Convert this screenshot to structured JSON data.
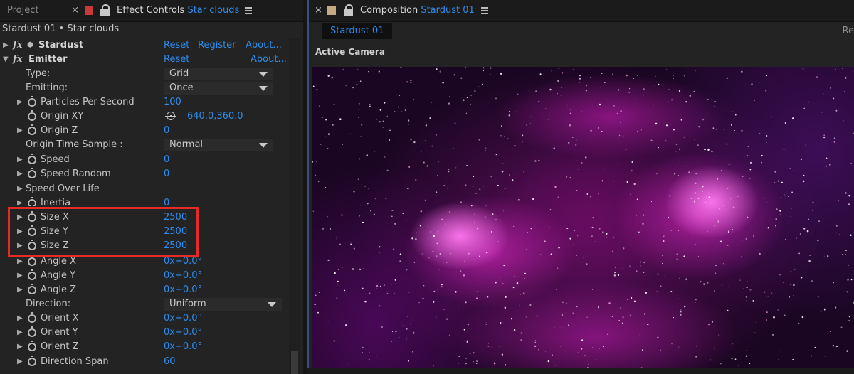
{
  "left_panel": {
    "tabs": {
      "project_label": "Project",
      "effect_controls_label": "Effect Controls",
      "effect_controls_layer": "Star clouds"
    },
    "breadcrumb": "Stardust 01 • Star clouds",
    "stardust": {
      "name": "Stardust",
      "reset": "Reset",
      "register": "Register",
      "about": "About..."
    },
    "emitter": {
      "name": "Emitter",
      "reset": "Reset",
      "about": "About..."
    },
    "properties": {
      "type": {
        "label": "Type:",
        "value": "Grid"
      },
      "emitting": {
        "label": "Emitting:",
        "value": "Once"
      },
      "particles_per_second": {
        "label": "Particles Per Second",
        "value": "100"
      },
      "origin_xy": {
        "label": "Origin XY",
        "value": "640.0,360.0"
      },
      "origin_z": {
        "label": "Origin Z",
        "value": "0"
      },
      "origin_time_sample": {
        "label": "Origin Time Sample :",
        "value": "Normal"
      },
      "speed": {
        "label": "Speed",
        "value": "0"
      },
      "speed_random": {
        "label": "Speed Random",
        "value": "0"
      },
      "speed_over_life": {
        "label": "Speed Over Life"
      },
      "inertia": {
        "label": "Inertia",
        "value": "0"
      },
      "size_x": {
        "label": "Size X",
        "value": "2500"
      },
      "size_y": {
        "label": "Size Y",
        "value": "2500"
      },
      "size_z": {
        "label": "Size Z",
        "value": "2500"
      },
      "angle_x": {
        "label": "Angle X",
        "value": "0x+0.0°"
      },
      "angle_y": {
        "label": "Angle Y",
        "value": "0x+0.0°"
      },
      "angle_z": {
        "label": "Angle Z",
        "value": "0x+0.0°"
      },
      "direction": {
        "label": "Direction:",
        "value": "Uniform"
      },
      "orient_x": {
        "label": "Orient X",
        "value": "0x+0.0°"
      },
      "orient_y": {
        "label": "Orient Y",
        "value": "0x+0.0°"
      },
      "orient_z": {
        "label": "Orient Z",
        "value": "0x+0.0°"
      },
      "direction_span": {
        "label": "Direction Span",
        "value": "60"
      }
    }
  },
  "right_panel": {
    "tab_label": "Composition",
    "composition_name": "Stardust 01",
    "subtab": "Stardust 01",
    "cut_off_text": "Re",
    "view_label": "Active Camera"
  },
  "colors": {
    "accent": "#2d8ceb",
    "highlight_box": "#e52a2a",
    "effect_label_color": "#c83a3a",
    "comp_label_color": "#c4a982"
  }
}
